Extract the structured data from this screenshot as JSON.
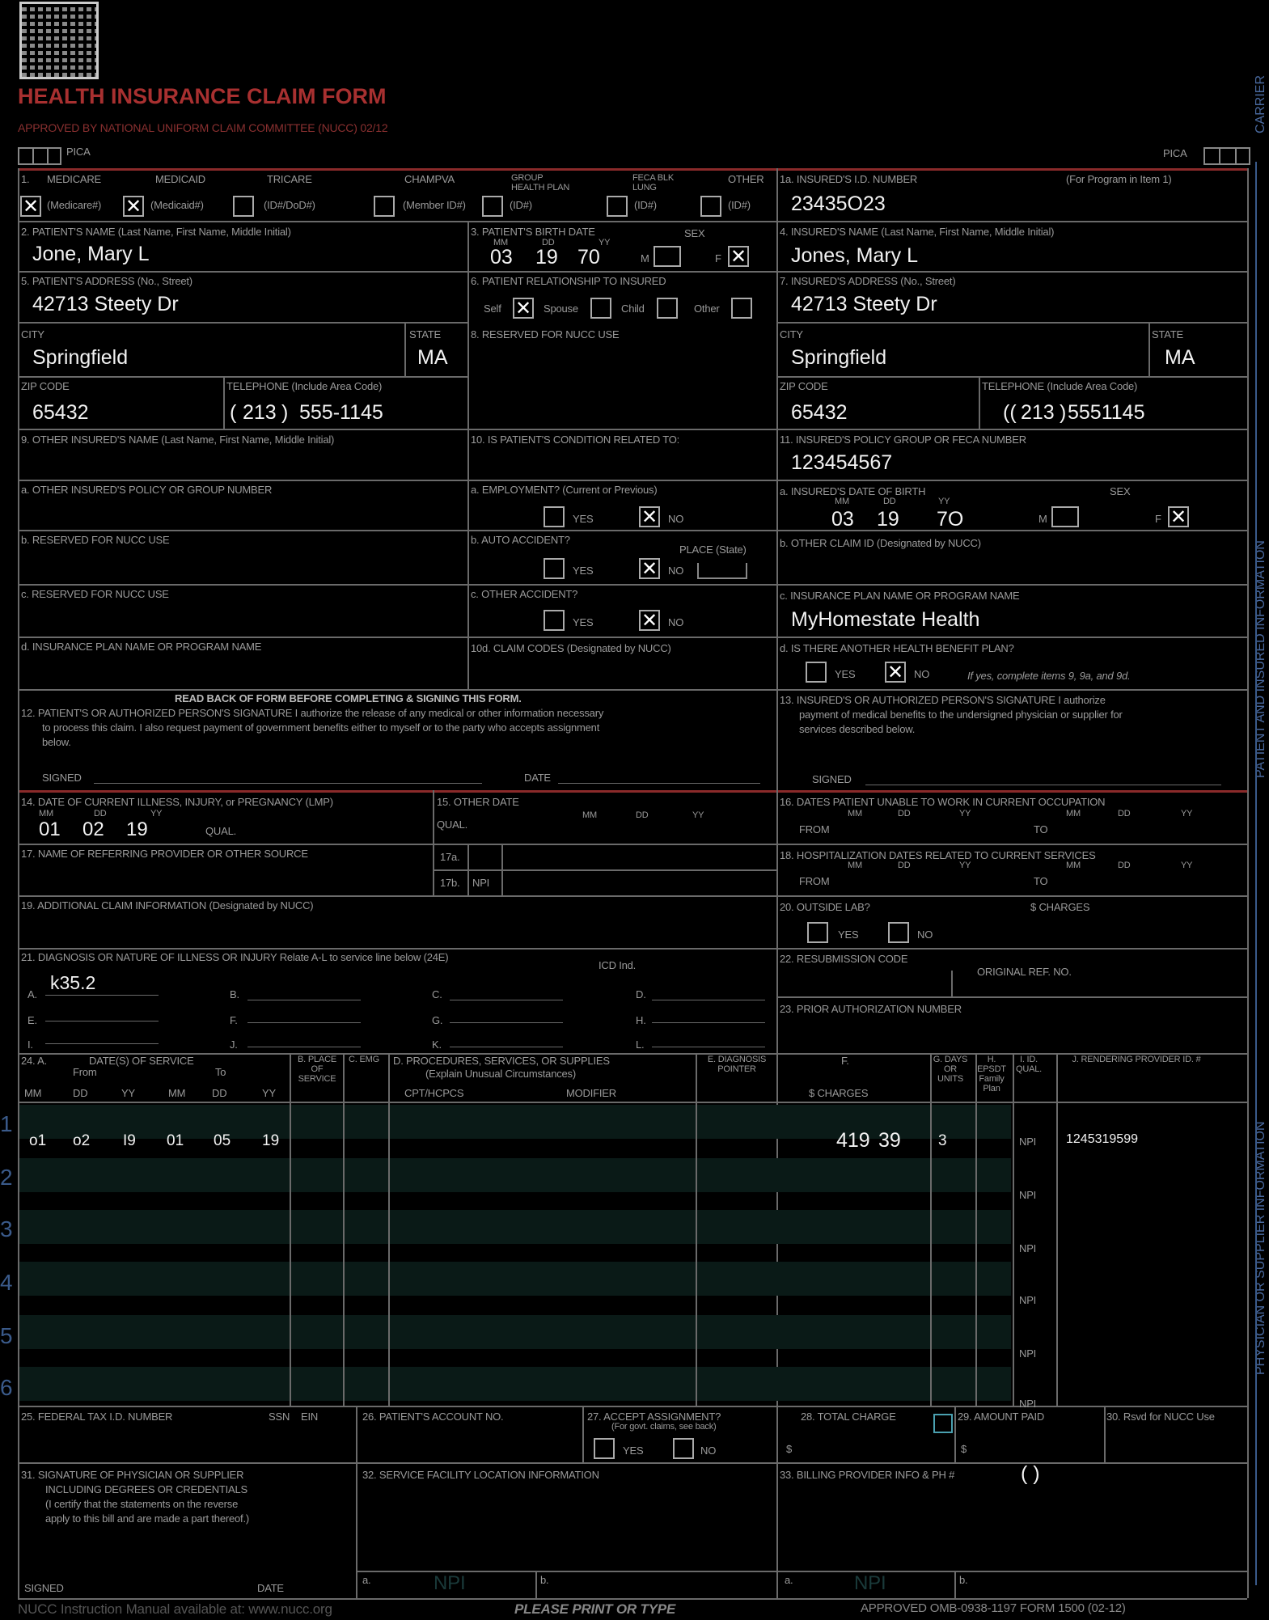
{
  "form": {
    "title": "HEALTH INSURANCE CLAIM FORM",
    "approved": "APPROVED BY NATIONAL UNIFORM CLAIM COMMITTEE (NUCC) 02/12",
    "pica": "PICA",
    "pica_right": "PICA"
  },
  "side": {
    "carrier": "CARRIER",
    "patient_insured": "PATIENT AND INSURED INFORMATION",
    "physician": "PHYSICIAN OR SUPPLIER INFORMATION"
  },
  "box1": {
    "label": "1.",
    "medicare": "MEDICARE",
    "medicaid": "MEDICAID",
    "tricare": "TRICARE",
    "champva": "CHAMPVA",
    "group": "GROUP HEALTH PLAN",
    "feca": "FECA BLK LUNG",
    "other": "OTHER",
    "medicare_sub": "(Medicare#)",
    "medicaid_sub": "(Medicaid#)",
    "tricare_sub": "(ID#/DoD#)",
    "champva_sub": "(Member ID#)",
    "group_sub": "(ID#)",
    "feca_sub": "(ID#)",
    "other_sub": "(ID#)"
  },
  "box1a": {
    "label": "1a. INSURED'S I.D. NUMBER",
    "note": "(For Program in Item 1)",
    "value": "23435O23"
  },
  "box2": {
    "label": "2. PATIENT'S NAME (Last Name, First Name, Middle Initial)",
    "value": "Jone, Mary L"
  },
  "box3": {
    "label": "3. PATIENT'S BIRTH DATE",
    "sex": "SEX",
    "mm": "MM",
    "dd": "DD",
    "yy": "YY",
    "m_val": "03",
    "d_val": "19",
    "y_val": "70",
    "m": "M",
    "f": "F"
  },
  "box4": {
    "label": "4. INSURED'S NAME (Last Name, First Name, Middle Initial)",
    "value": "Jones, Mary L"
  },
  "box5": {
    "label": "5. PATIENT'S ADDRESS (No., Street)",
    "value": "42713 Steety Dr",
    "city_label": "CITY",
    "city": "Springfield",
    "state_label": "STATE",
    "state": "MA",
    "zip_label": "ZIP CODE",
    "zip": "65432",
    "tel_label": "TELEPHONE (Include Area Code)",
    "area": "213",
    "phone": "555-1145"
  },
  "box6": {
    "label": "6. PATIENT RELATIONSHIP TO INSURED",
    "self": "Self",
    "spouse": "Spouse",
    "child": "Child",
    "other": "Other"
  },
  "box7": {
    "label": "7. INSURED'S ADDRESS (No., Street)",
    "value": "42713 Steety Dr",
    "city_label": "CITY",
    "city": "Springfield",
    "state_label": "STATE",
    "state": "MA",
    "zip_label": "ZIP CODE",
    "zip": "65432",
    "tel_label": "TELEPHONE (Include Area Code)",
    "area": "213",
    "phone": "5551145"
  },
  "box8": {
    "label": "8. RESERVED FOR NUCC USE"
  },
  "box9": {
    "label": "9. OTHER INSURED'S NAME (Last Name, First Name, Middle Initial)",
    "a": "a. OTHER INSURED'S POLICY OR GROUP NUMBER",
    "b": "b. RESERVED FOR NUCC USE",
    "c": "c. RESERVED FOR NUCC USE",
    "d": "d. INSURANCE PLAN NAME OR PROGRAM NAME"
  },
  "box10": {
    "label": "10. IS PATIENT'S CONDITION RELATED TO:",
    "a": "a. EMPLOYMENT? (Current or Previous)",
    "b": "b. AUTO ACCIDENT?",
    "place": "PLACE (State)",
    "c": "c. OTHER ACCIDENT?",
    "d": "10d. CLAIM CODES (Designated by NUCC)",
    "yes": "YES",
    "no": "NO"
  },
  "box11": {
    "label": "11. INSURED'S POLICY GROUP OR FECA NUMBER",
    "value": "123454567",
    "a": "a. INSURED'S DATE OF BIRTH",
    "sex": "SEX",
    "mm": "MM",
    "dd": "DD",
    "yy": "YY",
    "m_val": "03",
    "d_val": "19",
    "y_val": "7O",
    "m": "M",
    "f": "F",
    "b": "b. OTHER CLAIM ID (Designated by NUCC)",
    "c": "c. INSURANCE PLAN NAME OR PROGRAM NAME",
    "c_val": "MyHomestate Health",
    "d": "d. IS THERE ANOTHER HEALTH BENEFIT PLAN?",
    "yes": "YES",
    "no": "NO",
    "d_note": "If yes, complete items 9, 9a, and 9d."
  },
  "box12": {
    "heading": "READ BACK OF FORM BEFORE COMPLETING & SIGNING THIS FORM.",
    "label": "12. PATIENT'S OR AUTHORIZED PERSON'S SIGNATURE I authorize the release of any medical or other information necessary",
    "line2": "to process this claim. I also request payment of government benefits either to myself or to the party who accepts assignment",
    "line3": "below.",
    "signed": "SIGNED",
    "date": "DATE"
  },
  "box13": {
    "label": "13. INSURED'S OR AUTHORIZED PERSON'S SIGNATURE I authorize",
    "line2": "payment of medical benefits to the undersigned physician or supplier for",
    "line3": "services described below.",
    "signed": "SIGNED"
  },
  "box14": {
    "label": "14. DATE OF CURRENT ILLNESS, INJURY, or PREGNANCY (LMP)",
    "mm": "MM",
    "dd": "DD",
    "yy": "YY",
    "m_val": "01",
    "d_val": "02",
    "y_val": "19",
    "qual": "QUAL."
  },
  "box15": {
    "label": "15. OTHER DATE",
    "qual": "QUAL.",
    "mm": "MM",
    "dd": "DD",
    "yy": "YY"
  },
  "box16": {
    "label": "16. DATES PATIENT UNABLE TO WORK IN CURRENT OCCUPATION",
    "from": "FROM",
    "to": "TO",
    "mm": "MM",
    "dd": "DD",
    "yy": "YY"
  },
  "box17": {
    "label": "17. NAME OF REFERRING PROVIDER OR OTHER SOURCE",
    "a": "17a.",
    "b": "17b.",
    "npi": "NPI"
  },
  "box18": {
    "label": "18. HOSPITALIZATION DATES RELATED TO CURRENT SERVICES",
    "from": "FROM",
    "to": "TO",
    "mm": "MM",
    "dd": "DD",
    "yy": "YY"
  },
  "box19": {
    "label": "19. ADDITIONAL CLAIM INFORMATION (Designated by NUCC)"
  },
  "box20": {
    "label": "20. OUTSIDE LAB?",
    "charges": "$ CHARGES",
    "yes": "YES",
    "no": "NO"
  },
  "box21": {
    "label": "21. DIAGNOSIS OR NATURE OF ILLNESS OR INJURY Relate A-L to service line below (24E)",
    "icd": "ICD Ind.",
    "a": "A.",
    "b": "B.",
    "c": "C.",
    "d": "D.",
    "e": "E.",
    "f": "F.",
    "g": "G.",
    "h": "H.",
    "i": "I.",
    "j": "J.",
    "k": "K.",
    "l": "L.",
    "a_val": "k35.2"
  },
  "box22": {
    "label": "22. RESUBMISSION CODE",
    "orig": "ORIGINAL REF. NO."
  },
  "box23": {
    "label": "23. PRIOR AUTHORIZATION NUMBER"
  },
  "box24": {
    "a": "24. A.",
    "dates": "DATE(S) OF SERVICE",
    "from": "From",
    "to": "To",
    "mm": "MM",
    "dd": "DD",
    "yy": "YY",
    "b": "B. PLACE OF SERVICE",
    "c": "C. EMG",
    "d": "D. PROCEDURES, SERVICES, OR SUPPLIES",
    "d_sub": "(Explain Unusual Circumstances)",
    "cpt": "CPT/HCPCS",
    "modifier": "MODIFIER",
    "e": "E. DIAGNOSIS POINTER",
    "f": "F.",
    "charges": "$ CHARGES",
    "g": "G. DAYS OR UNITS",
    "h": "H. EPSDT Family Plan",
    "i": "I. ID. QUAL.",
    "j": "J. RENDERING PROVIDER ID. #",
    "npi": "NPI",
    "rows": [
      {
        "n": "1",
        "fm": "o1",
        "fd": "o2",
        "fy": "I9",
        "tm": "01",
        "td": "05",
        "ty": "19",
        "charge": "419",
        "cents": "39",
        "units": "3",
        "provider": "1245319599"
      },
      {
        "n": "2"
      },
      {
        "n": "3"
      },
      {
        "n": "4"
      },
      {
        "n": "5"
      },
      {
        "n": "6"
      }
    ]
  },
  "box25": {
    "label": "25. FEDERAL TAX I.D. NUMBER",
    "ssn": "SSN",
    "ein": "EIN"
  },
  "box26": {
    "label": "26. PATIENT'S ACCOUNT NO."
  },
  "box27": {
    "label": "27. ACCEPT ASSIGNMENT?",
    "sub": "(For govt. claims, see back)",
    "yes": "YES",
    "no": "NO"
  },
  "box28": {
    "label": "28. TOTAL CHARGE",
    "dollar": "$"
  },
  "box29": {
    "label": "29. AMOUNT PAID",
    "dollar": "$"
  },
  "box30": {
    "label": "30. Rsvd for NUCC Use"
  },
  "box31": {
    "label": "31. SIGNATURE OF PHYSICIAN OR SUPPLIER",
    "l2": "INCLUDING DEGREES OR CREDENTIALS",
    "l3": "(I certify that the statements on the reverse",
    "l4": "apply to this bill and are made a part thereof.)",
    "signed": "SIGNED",
    "date": "DATE"
  },
  "box32": {
    "label": "32. SERVICE FACILITY LOCATION INFORMATION",
    "a": "a.",
    "b": "b.",
    "npi": "NPI"
  },
  "box33": {
    "label": "33. BILLING PROVIDER INFO & PH #",
    "paren": "(          )",
    "a": "a.",
    "b": "b.",
    "npi": "NPI"
  },
  "footer": {
    "left": "NUCC Instruction Manual available at: www.nucc.org",
    "center": "PLEASE PRINT OR TYPE",
    "right": "APPROVED OMB-0938-1197 FORM 1500 (02-12)"
  }
}
